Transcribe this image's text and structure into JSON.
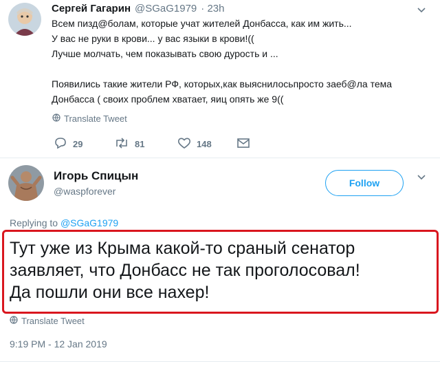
{
  "tweet1": {
    "name": "Сергей Гагарин",
    "handle": "@SGaG1979",
    "time": "· 23h",
    "lines": [
      "Всем пизд@болам, которые учат жителей Донбасса, как им жить...",
      "У вас не руки в крови... у вас языки в крови!((",
      "Лучше молчать, чем показывать свою дурость и ...",
      "",
      "Появились такие жители РФ, которых,как выяснилосьпросто заеб@ла тема",
      "Донбасса ( своих проблем хватает, яиц опять же 9(("
    ],
    "translate_label": "Translate Tweet",
    "reply_count": "29",
    "retweet_count": "81",
    "like_count": "148"
  },
  "tweet2": {
    "name": "Игорь Спицын",
    "handle": "@waspforever",
    "follow_label": "Follow",
    "replying_prefix": "Replying to",
    "replying_handle": "@SGaG1979",
    "lines": [
      "Тут уже из Крыма какой-то сраный сенатор",
      "заявляет, что Донбасс не так проголосовал!",
      "Да пошли они все нахер!"
    ],
    "translate_label": "Translate Tweet",
    "timestamp": "9:19 PM - 12 Jan 2019"
  },
  "colors": {
    "accent": "#1da1f2",
    "secondary_text": "#657786",
    "highlight": "#d9161e"
  }
}
